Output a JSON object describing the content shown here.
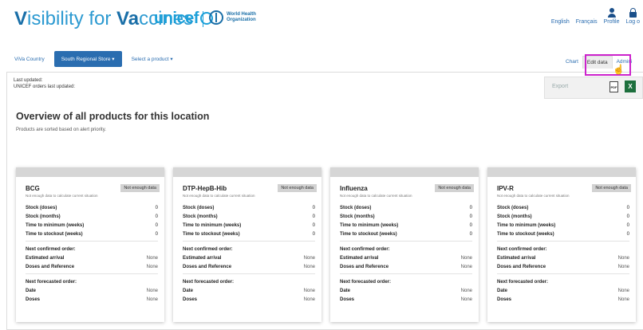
{
  "header": {
    "title_v": "V",
    "title_rest1": "isibility for ",
    "title_v2": "Va",
    "title_rest2": "ccines",
    "unicef": "unicef",
    "who_line1": "World Health",
    "who_line2": "Organization",
    "links": [
      "English",
      "Français"
    ],
    "profile": "Profile",
    "logout": "Log o"
  },
  "nav": {
    "country": "ViVa Country",
    "store": "South Regional Store ▾",
    "product": "Select a product ▾"
  },
  "tabs": {
    "chart": "Chart",
    "edit": "Edit data",
    "admin": "Admini"
  },
  "export": {
    "label": "Export",
    "pdf": "PDF",
    "xls": "X"
  },
  "updated": {
    "line1": "Last updated:",
    "line2": "UNICEF orders last updated:"
  },
  "main": {
    "title": "Overview of all products for this location",
    "subtitle": "Products are sorted based on alert priority."
  },
  "card_labels": {
    "stock_doses": "Stock (doses)",
    "stock_months": "Stock (months)",
    "time_min": "Time to minimum (weeks)",
    "time_stockout": "Time to stockout (weeks)",
    "next_confirmed": "Next confirmed order:",
    "est_arrival": "Estimated arrival",
    "doses_ref": "Doses and Reference",
    "next_forecast": "Next forecasted order:",
    "date": "Date",
    "doses": "Doses"
  },
  "cards": [
    {
      "name": "BCG",
      "badge": "Not enough data",
      "note": "Not enough data to calculate current situation",
      "stock_doses": "0",
      "stock_months": "0",
      "time_min": "0",
      "time_stockout": "0",
      "est_arrival": "None",
      "doses_ref": "None",
      "date": "None",
      "doses": "None"
    },
    {
      "name": "DTP-HepB-Hib",
      "badge": "Not enough data",
      "note": "Not enough data to calculate current situation",
      "stock_doses": "0",
      "stock_months": "0",
      "time_min": "0",
      "time_stockout": "0",
      "est_arrival": "None",
      "doses_ref": "None",
      "date": "None",
      "doses": "None"
    },
    {
      "name": "Influenza",
      "badge": "Not enough data",
      "note": "Not enough data to calculate current situation",
      "stock_doses": "0",
      "stock_months": "0",
      "time_min": "0",
      "time_stockout": "0",
      "est_arrival": "None",
      "doses_ref": "None",
      "date": "None",
      "doses": "None"
    },
    {
      "name": "IPV-R",
      "badge": "Not enough data",
      "note": "Not enough data to calculate current situation",
      "stock_doses": "0",
      "stock_months": "0",
      "time_min": "0",
      "time_stockout": "0",
      "est_arrival": "None",
      "doses_ref": "None",
      "date": "None",
      "doses": "None"
    }
  ]
}
